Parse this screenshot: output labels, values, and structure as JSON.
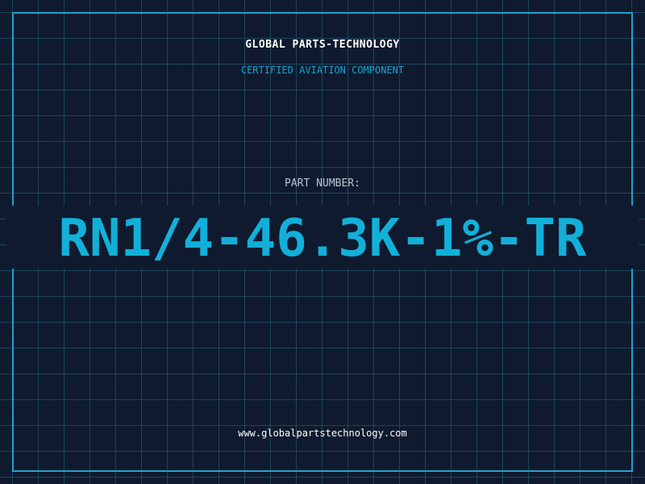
{
  "header": {
    "company_name": "GLOBAL PARTS-TECHNOLOGY",
    "tagline": "CERTIFIED AVIATION COMPONENT"
  },
  "part": {
    "label": "PART NUMBER:",
    "number": "RN1/4-46.3K-1%-TR"
  },
  "footer": {
    "website": "www.globalpartstechnology.com"
  },
  "colors": {
    "background": "#0f1a2e",
    "grid": "#2c7896",
    "accent": "#1ba3cf",
    "part_number": "#12b0d9",
    "label": "#b8c4d2",
    "text": "#ffffff"
  }
}
